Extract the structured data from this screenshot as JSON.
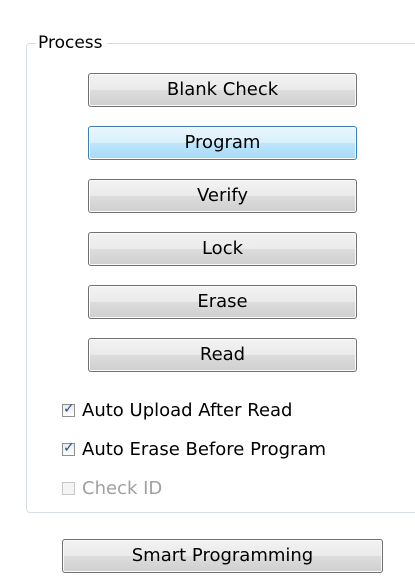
{
  "process_group": {
    "title": "Process",
    "buttons": [
      {
        "label": "Blank Check"
      },
      {
        "label": "Program"
      },
      {
        "label": "Verify"
      },
      {
        "label": "Lock"
      },
      {
        "label": "Erase"
      },
      {
        "label": "Read"
      }
    ],
    "checkboxes": [
      {
        "label": "Auto Upload After Read",
        "checked": true,
        "enabled": true
      },
      {
        "label": "Auto Erase Before Program",
        "checked": true,
        "enabled": true
      },
      {
        "label": "Check ID",
        "checked": false,
        "enabled": false
      }
    ]
  },
  "smart_programming_button": {
    "label": "Smart Programming"
  },
  "colors": {
    "focused_button_border": "#3c7fb1",
    "checkmark": "#2b4c8e",
    "disabled_text": "#a0a0a0"
  }
}
